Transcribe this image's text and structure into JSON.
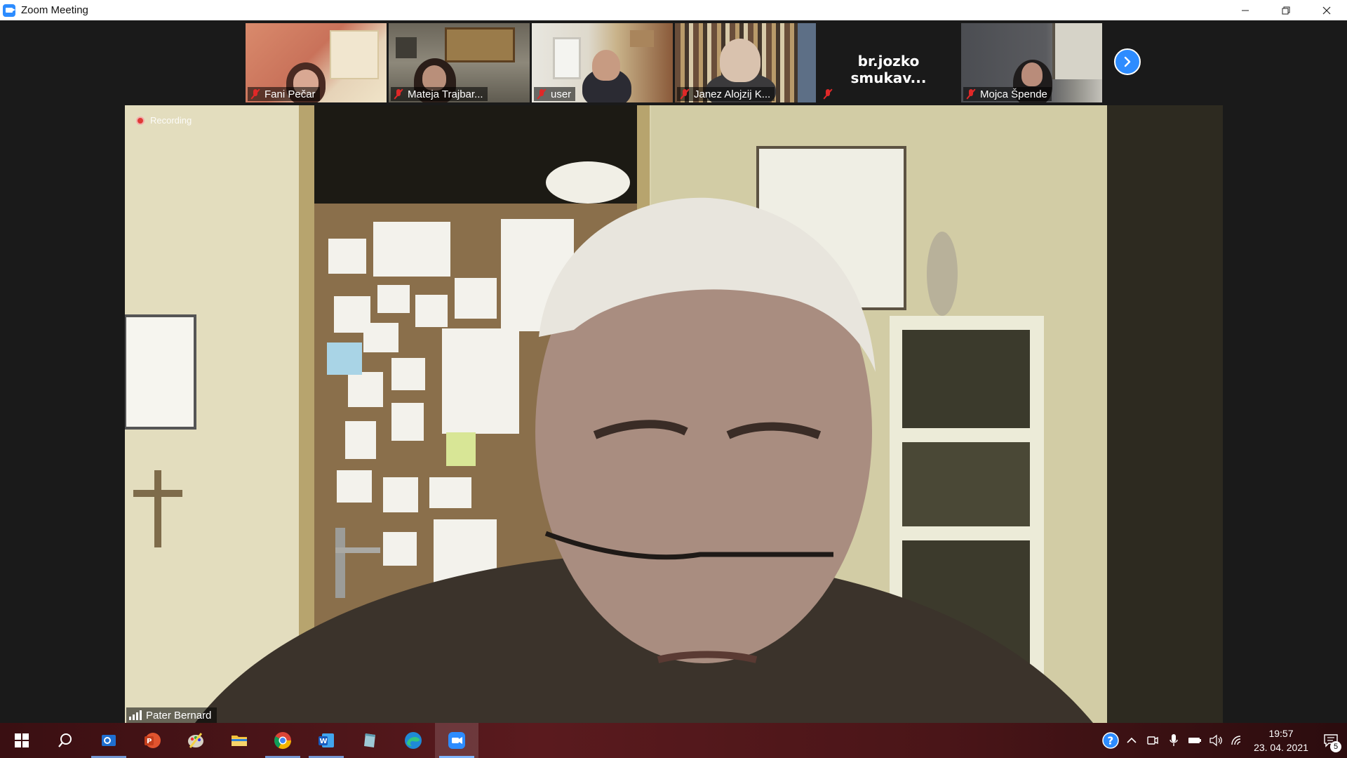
{
  "window": {
    "title": "Zoom Meeting",
    "minimize_icon": "minimize-icon",
    "restore_icon": "restore-icon",
    "close_icon": "close-icon"
  },
  "participants": [
    {
      "name": "Fani Pečar",
      "muted": true,
      "video": true
    },
    {
      "name": "Mateja Trajbar...",
      "muted": true,
      "video": true
    },
    {
      "name": "user",
      "muted": true,
      "video": true
    },
    {
      "name": "Janez Alojzij K...",
      "muted": true,
      "video": true
    },
    {
      "name": "",
      "display_name": "br.jozko  smukav...",
      "muted": true,
      "video": false
    },
    {
      "name": "Mojca Špende",
      "muted": true,
      "video": true
    }
  ],
  "next_page_icon": "chevron-right-icon",
  "main_video": {
    "recording_label": "Recording",
    "speaker_name": "Pater Bernard"
  },
  "taskbar": {
    "apps": [
      "start",
      "search",
      "outlook",
      "powerpoint",
      "paint",
      "file-explorer",
      "chrome",
      "word",
      "notes",
      "edge",
      "zoom"
    ],
    "clock_time": "19:57",
    "clock_date": "23. 04. 2021",
    "notification_count": "5"
  },
  "colors": {
    "zoom_blue": "#2d8cff",
    "muted_red": "#e02828"
  }
}
